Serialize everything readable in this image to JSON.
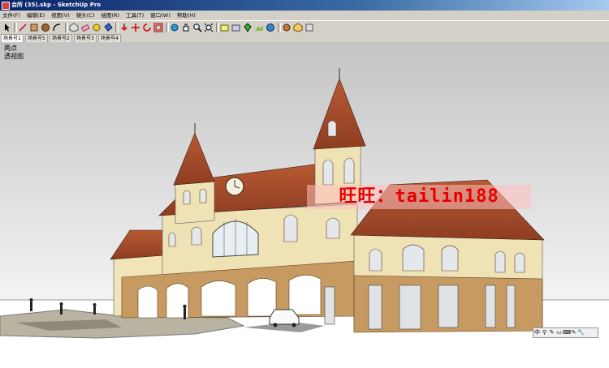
{
  "window": {
    "title": "会所 (35).skp - SketchUp Pro"
  },
  "menu": [
    "文件(F)",
    "编辑(E)",
    "视图(V)",
    "镜头(C)",
    "绘图(R)",
    "工具(T)",
    "窗口(W)",
    "帮助(H)"
  ],
  "toolbar": {
    "tools": [
      "select-tool-icon",
      "line-tool-icon",
      "rectangle-tool-icon",
      "circle-tool-icon",
      "arc-tool-icon",
      "make-component-icon",
      "eraser-icon",
      "tape-measure-icon",
      "paint-bucket-icon",
      "push-pull-icon",
      "move-icon",
      "rotate-icon",
      "offset-icon",
      "orbit-icon",
      "pan-icon",
      "zoom-icon",
      "zoom-extents-icon",
      "get-models-icon",
      "share-model-icon",
      "add-location-icon",
      "toggle-terrain-icon",
      "google-earth-icon",
      "get-photo-texture-icon",
      "share-component-icon",
      "extension-warehouse-icon"
    ]
  },
  "scenes": [
    "场景号1",
    "场景号5",
    "场景号2",
    "场景号3",
    "场景号4"
  ],
  "active_scene": "场景号1",
  "viewport": {
    "camera_label_1": "两点",
    "camera_label_2": "透视图",
    "watermark": "旺旺：tailin188"
  },
  "corner_toolbar": [
    "中",
    "⚲",
    "✎",
    "▭",
    "⌨",
    "✎",
    "🔧"
  ],
  "colors": {
    "sky_top": "#c8c8c8",
    "sky_bottom": "#ffffff",
    "roof": "#a24a2a",
    "wall": "#f0e4b8",
    "stone": "#c79a62",
    "watermark": "#e60000"
  }
}
